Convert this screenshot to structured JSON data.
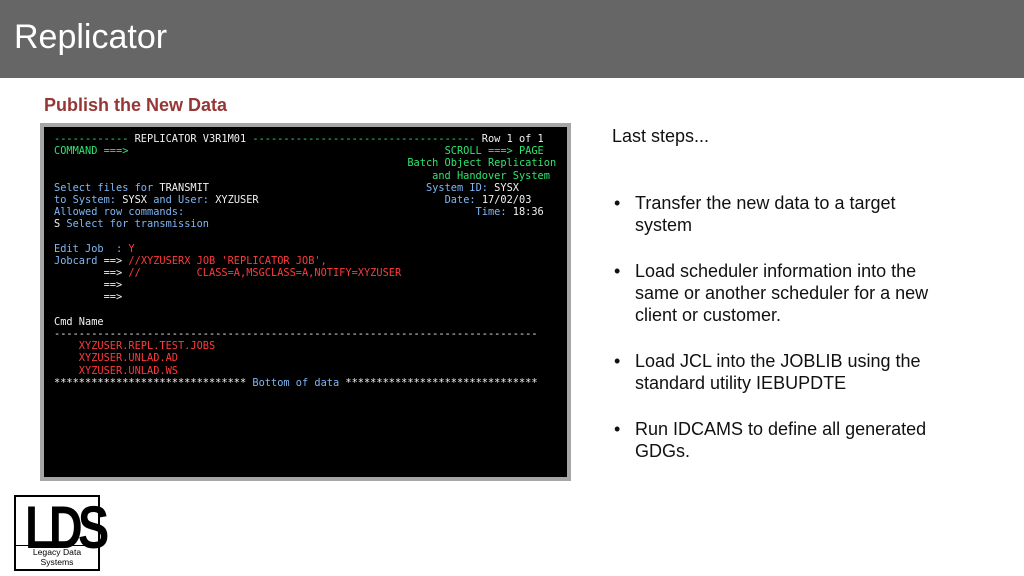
{
  "slide": {
    "title": "Replicator",
    "subtitle": "Publish the New Data"
  },
  "terminal": {
    "lines": [
      [
        {
          "t": "------------ ",
          "c": "green"
        },
        {
          "t": "REPLICATOR V3R1M01",
          "c": "white"
        },
        {
          "t": " ------------------------------------ ",
          "c": "green"
        },
        {
          "t": "Row 1 of 1",
          "c": "white"
        }
      ],
      [
        {
          "t": "COMMAND ===>                                                   ",
          "c": "green"
        },
        {
          "t": "SCROLL ===> PAGE",
          "c": "green"
        }
      ],
      [
        {
          "t": "                                                         Batch Object Replication",
          "c": "green"
        }
      ],
      [
        {
          "t": "                                                             and Handover System",
          "c": "green"
        }
      ],
      [
        {
          "t": "Select files for ",
          "c": "cyan"
        },
        {
          "t": "TRANSMIT",
          "c": "white"
        },
        {
          "t": "                                   System ID: ",
          "c": "cyan"
        },
        {
          "t": "SYSX",
          "c": "white"
        }
      ],
      [
        {
          "t": "to System: ",
          "c": "cyan"
        },
        {
          "t": "SYSX",
          "c": "white"
        },
        {
          "t": " and User: ",
          "c": "cyan"
        },
        {
          "t": "XYZUSER",
          "c": "white"
        },
        {
          "t": "                              Date: ",
          "c": "cyan"
        },
        {
          "t": "17/02/03",
          "c": "white"
        }
      ],
      [
        {
          "t": "Allowed row commands:                                               Time: ",
          "c": "cyan"
        },
        {
          "t": "18:36",
          "c": "white"
        }
      ],
      [
        {
          "t": "S",
          "c": "white"
        },
        {
          "t": " Select for transmission",
          "c": "cyan"
        }
      ],
      [
        {
          "t": "",
          "c": "white"
        }
      ],
      [
        {
          "t": "Edit Job  : ",
          "c": "cyan"
        },
        {
          "t": "Y",
          "c": "red"
        }
      ],
      [
        {
          "t": "Jobcard ",
          "c": "cyan"
        },
        {
          "t": "==> ",
          "c": "white"
        },
        {
          "t": "//XYZUSERX JOB 'REPLICATOR JOB',",
          "c": "red"
        }
      ],
      [
        {
          "t": "        ==> ",
          "c": "white"
        },
        {
          "t": "//         CLASS=A,MSGCLASS=A,NOTIFY=XYZUSER",
          "c": "red"
        }
      ],
      [
        {
          "t": "        ==>",
          "c": "white"
        }
      ],
      [
        {
          "t": "        ==>",
          "c": "white"
        }
      ],
      [
        {
          "t": "",
          "c": "white"
        }
      ],
      [
        {
          "t": "Cmd Name",
          "c": "white"
        }
      ],
      [
        {
          "t": "------------------------------------------------------------------------------",
          "c": "white"
        }
      ],
      [
        {
          "t": "    XYZUSER.REPL.TEST.JOBS",
          "c": "red"
        }
      ],
      [
        {
          "t": "    XYZUSER.UNLAD.AD",
          "c": "red"
        }
      ],
      [
        {
          "t": "    XYZUSER.UNLAD.WS",
          "c": "red"
        }
      ],
      [
        {
          "t": "******************************* ",
          "c": "white"
        },
        {
          "t": "Bottom of data",
          "c": "cyan"
        },
        {
          "t": " *******************************",
          "c": "white"
        }
      ]
    ]
  },
  "notes": {
    "lead": "Last steps...",
    "bullets": [
      "Transfer the new data to a target system",
      "Load scheduler information into the same or another scheduler for a new client or customer.",
      "Load JCL into the JOBLIB using the standard utility IEBUPDTE",
      "Run IDCAMS to define all generated GDGs."
    ],
    "bullet_glyph": "•"
  },
  "logo": {
    "letters": "LDS",
    "tagline": "Legacy Data Systems"
  },
  "colors": {
    "title_bar": "#666666",
    "subtitle": "#953735",
    "terminal_bg": "#000000",
    "terminal_frame": "#a6a6a6"
  }
}
